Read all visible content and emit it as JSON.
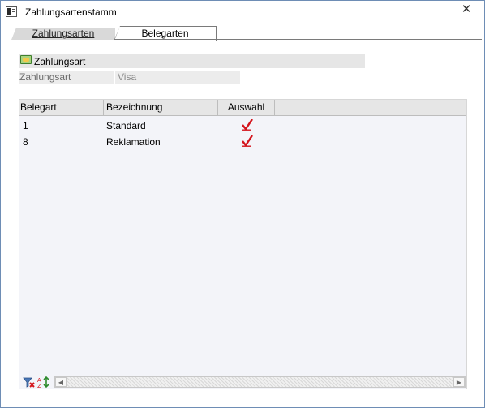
{
  "window": {
    "title": "Zahlungsartenstamm",
    "close_glyph": "✕"
  },
  "tabs": [
    {
      "label": "Zahlungsarten",
      "active": false
    },
    {
      "label": "Belegarten",
      "active": true
    }
  ],
  "section": {
    "title": "Zahlungsart",
    "icon": "payment-card-icon"
  },
  "fields": {
    "zahlungsart_label": "Zahlungsart",
    "zahlungsart_value": "Visa"
  },
  "grid": {
    "columns": [
      "Belegart",
      "Bezeichnung",
      "Auswahl"
    ],
    "rows": [
      {
        "belegart": "1",
        "bezeichnung": "Standard",
        "auswahl": true
      },
      {
        "belegart": "8",
        "bezeichnung": "Reklamation",
        "auswahl": true
      }
    ]
  },
  "footer": {
    "scroll_left_glyph": "◀",
    "scroll_right_glyph": "▶"
  },
  "colors": {
    "check": "#d4141c",
    "window_border": "#6e8db5"
  }
}
